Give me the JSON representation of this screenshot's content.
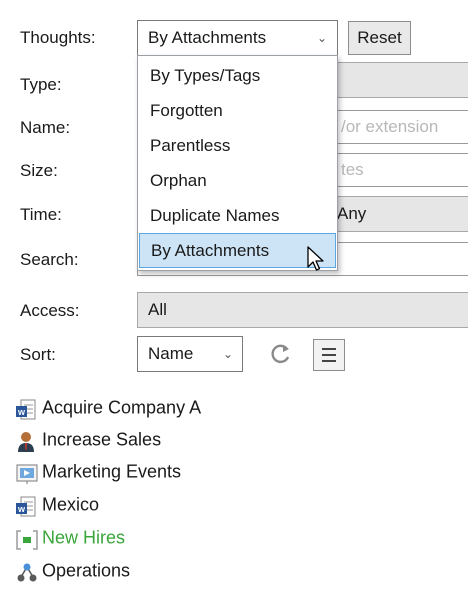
{
  "form": {
    "thoughts": {
      "label": "Thoughts:",
      "value": "By Attachments",
      "reset": "Reset"
    },
    "type": {
      "label": "Type:"
    },
    "name": {
      "label": "Name:",
      "placeholder": "/or extension"
    },
    "size": {
      "label": "Size:",
      "placeholder": "tes"
    },
    "time": {
      "label": "Time:",
      "value": "Any"
    },
    "search": {
      "label": "Search:"
    },
    "access": {
      "label": "Access:",
      "value": "All"
    },
    "sort": {
      "label": "Sort:",
      "value": "Name"
    }
  },
  "dropdown": {
    "items": [
      "By Types/Tags",
      "Forgotten",
      "Parentless",
      "Orphan",
      "Duplicate Names",
      "By Attachments"
    ],
    "selected": "By Attachments"
  },
  "list": [
    {
      "label": "Acquire Company A",
      "icon": "word-doc-icon",
      "color": "#1a1a1a"
    },
    {
      "label": "Increase Sales",
      "icon": "person-icon",
      "color": "#1a1a1a"
    },
    {
      "label": "Marketing Events",
      "icon": "presentation-icon",
      "color": "#1a1a1a"
    },
    {
      "label": "Mexico",
      "icon": "word-doc-icon",
      "color": "#1a1a1a"
    },
    {
      "label": "New Hires",
      "icon": "green-bracket-icon",
      "color": "#3aa53a"
    },
    {
      "label": "Operations",
      "icon": "org-chart-icon",
      "color": "#1a1a1a"
    }
  ],
  "colors": {
    "selection": "#cde4f7",
    "selection_border": "#5ea6e0",
    "accent_green": "#3aa53a",
    "word_blue": "#2b579a"
  }
}
